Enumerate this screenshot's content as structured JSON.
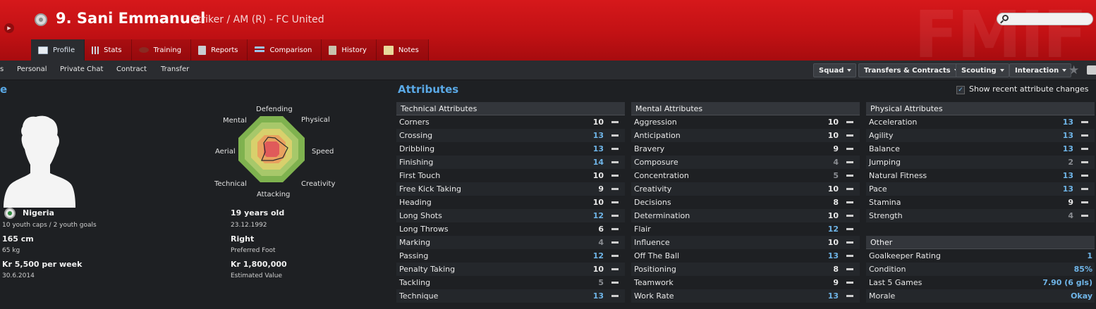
{
  "header": {
    "player_name": "9. Sani Emmanuel",
    "player_role": "Striker / AM (R) - FC United",
    "watermark": "FMIF",
    "search_placeholder": "",
    "tabs": [
      {
        "label": "Profile",
        "icon": "profile-icon",
        "active": true
      },
      {
        "label": "Stats",
        "icon": "stats-icon"
      },
      {
        "label": "Training",
        "icon": "training-icon"
      },
      {
        "label": "Reports",
        "icon": "reports-icon"
      },
      {
        "label": "Comparison",
        "icon": "comparison-icon"
      },
      {
        "label": "History",
        "icon": "history-icon"
      },
      {
        "label": "Notes",
        "icon": "notes-icon"
      }
    ]
  },
  "subnav": {
    "items": [
      "s",
      "Personal",
      "Private Chat",
      "Contract",
      "Transfer"
    ],
    "dropdowns": [
      "Squad",
      "Transfers & Contracts",
      "Scouting",
      "Interaction"
    ]
  },
  "profile": {
    "section_title": "e",
    "radar_labels": {
      "top": "Defending",
      "top_left": "Mental",
      "top_right": "Physical",
      "left": "Aerial",
      "right": "Speed",
      "bottom_left": "Technical",
      "bottom_right": "Creativity",
      "bottom": "Attacking"
    },
    "nationality": "Nigeria",
    "youth_caps": "10 youth caps / 2 youth goals",
    "height": "165 cm",
    "weight": "65 kg",
    "wage": "Kr 5,500 per week",
    "contract_end": "30.6.2014",
    "age": "19 years old",
    "dob": "23.12.1992",
    "preferred_foot": "Right",
    "preferred_foot_label": "Preferred Foot",
    "value": "Kr 1,800,000",
    "value_label": "Estimated Value"
  },
  "attributes": {
    "title": "Attributes",
    "recent_changes_label": "Show recent attribute changes",
    "recent_changes_checked": true,
    "technical": {
      "title": "Technical Attributes",
      "rows": [
        {
          "name": "Corners",
          "value": "10"
        },
        {
          "name": "Crossing",
          "value": "13"
        },
        {
          "name": "Dribbling",
          "value": "13"
        },
        {
          "name": "Finishing",
          "value": "14"
        },
        {
          "name": "First Touch",
          "value": "10"
        },
        {
          "name": "Free Kick Taking",
          "value": "9"
        },
        {
          "name": "Heading",
          "value": "10"
        },
        {
          "name": "Long Shots",
          "value": "12"
        },
        {
          "name": "Long Throws",
          "value": "6"
        },
        {
          "name": "Marking",
          "value": "4"
        },
        {
          "name": "Passing",
          "value": "12"
        },
        {
          "name": "Penalty Taking",
          "value": "10"
        },
        {
          "name": "Tackling",
          "value": "5"
        },
        {
          "name": "Technique",
          "value": "13"
        }
      ]
    },
    "mental": {
      "title": "Mental Attributes",
      "rows": [
        {
          "name": "Aggression",
          "value": "10"
        },
        {
          "name": "Anticipation",
          "value": "10"
        },
        {
          "name": "Bravery",
          "value": "9"
        },
        {
          "name": "Composure",
          "value": "4"
        },
        {
          "name": "Concentration",
          "value": "5"
        },
        {
          "name": "Creativity",
          "value": "10"
        },
        {
          "name": "Decisions",
          "value": "8"
        },
        {
          "name": "Determination",
          "value": "10"
        },
        {
          "name": "Flair",
          "value": "12"
        },
        {
          "name": "Influence",
          "value": "10"
        },
        {
          "name": "Off The Ball",
          "value": "13"
        },
        {
          "name": "Positioning",
          "value": "8"
        },
        {
          "name": "Teamwork",
          "value": "9"
        },
        {
          "name": "Work Rate",
          "value": "13"
        }
      ]
    },
    "physical": {
      "title": "Physical Attributes",
      "rows": [
        {
          "name": "Acceleration",
          "value": "13"
        },
        {
          "name": "Agility",
          "value": "13"
        },
        {
          "name": "Balance",
          "value": "13"
        },
        {
          "name": "Jumping",
          "value": "2"
        },
        {
          "name": "Natural Fitness",
          "value": "13"
        },
        {
          "name": "Pace",
          "value": "13"
        },
        {
          "name": "Stamina",
          "value": "9"
        },
        {
          "name": "Strength",
          "value": "4"
        }
      ]
    },
    "other": {
      "title": "Other",
      "rows": [
        {
          "name": "Goalkeeper Rating",
          "value": "1"
        },
        {
          "name": "Condition",
          "value": "85%"
        },
        {
          "name": "Last 5 Games",
          "value": "7.90 (6 gls)"
        },
        {
          "name": "Morale",
          "value": "Okay"
        }
      ]
    }
  }
}
